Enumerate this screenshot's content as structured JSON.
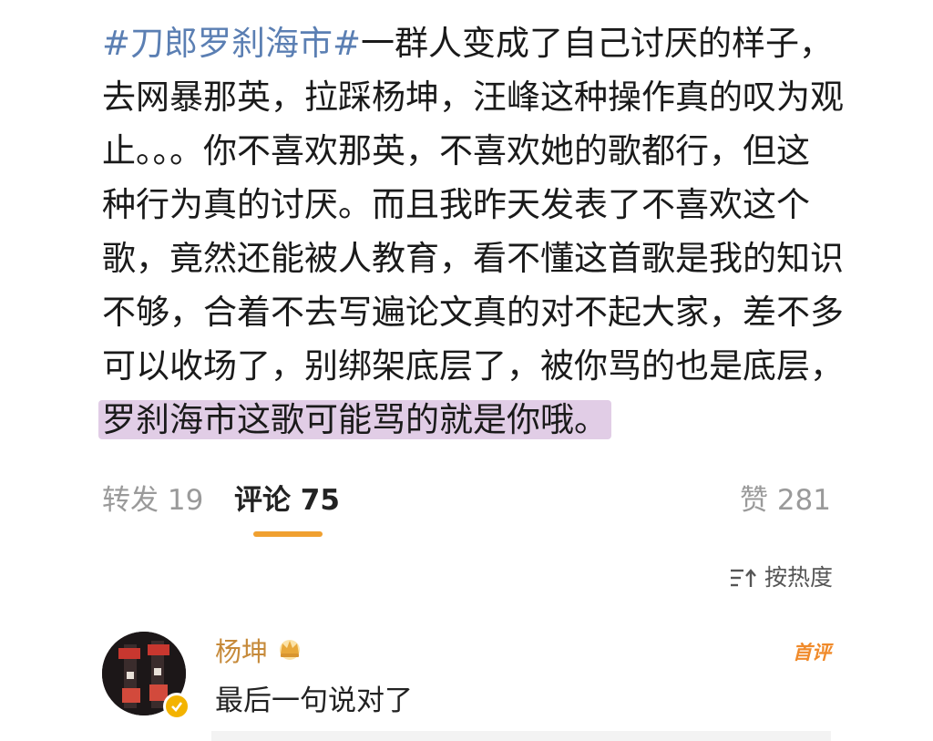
{
  "post": {
    "hashtag": "#刀郎罗刹海市#",
    "lines": [
      "一群人变成了自己讨厌的样子，",
      "去网暴那英，拉踩杨坤，汪峰这种操作真的叹为观",
      "止。。。你不喜欢那英，不喜欢她的歌都行，但这",
      "种行为真的讨厌。而且我昨天发表了不喜欢这个",
      "歌，竟然还能被人教育，看不懂这首歌是我的知识",
      "不够，合着不去写遍论文真的对不起大家，差不多",
      "可以收场了，别绑架底层了，被你骂的也是底层，"
    ],
    "highlighted_line": "罗刹海市这歌可能骂的就是你哦。"
  },
  "tabs": {
    "repost": "转发 19",
    "comment": "评论 75",
    "like": "赞 281"
  },
  "sort": {
    "label": "按热度",
    "icon": "sort-icon"
  },
  "comment": {
    "username": "杨坤",
    "badge_icon": "crown-icon",
    "first_label": "首评",
    "text": "最后一句说对了",
    "verified_icon": "verified-icon"
  },
  "colors": {
    "hashtag": "#5b7fb3",
    "highlight": "#e1cde6",
    "tab_underline": "#f0a030",
    "username": "#c68a3a",
    "first_badge": "#f08a2a"
  }
}
